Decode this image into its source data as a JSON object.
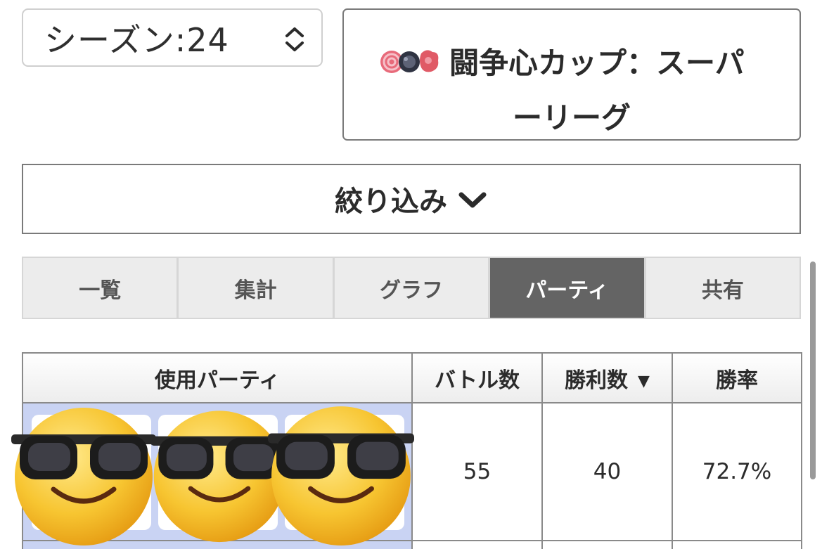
{
  "season": {
    "label": "シーズン:24"
  },
  "cup": {
    "line1": "闘争心カップ：スーパ",
    "line2": "ーリーグ"
  },
  "filter": {
    "label": "絞り込み"
  },
  "tabs": [
    "一覧",
    "集計",
    "グラフ",
    "パーティ",
    "共有"
  ],
  "active_tab": "パーティ",
  "table": {
    "headers": [
      "使用パーティ",
      "バトル数",
      "勝利数",
      "勝率"
    ],
    "sort_marker": "▼",
    "rows": [
      {
        "party_icons": [
          "sunglasses-face-icon",
          "sunglasses-face-icon",
          "sunglasses-face-icon"
        ],
        "battles": "55",
        "wins": "40",
        "rate": "72.7%"
      }
    ]
  },
  "colors": {
    "active_tab_bg": "#646464",
    "party_cell_bg": "#c9d3f3"
  }
}
